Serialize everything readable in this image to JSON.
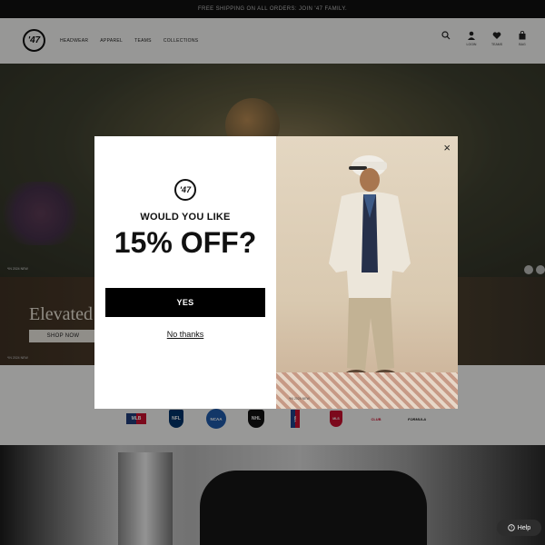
{
  "announcement": "FREE SHIPPING ON ALL ORDERS: JOIN '47 FAMILY.",
  "brand": {
    "logo_text": "'47"
  },
  "nav": [
    {
      "label": "HEADWEAR"
    },
    {
      "label": "APPAREL"
    },
    {
      "label": "TEAMS"
    },
    {
      "label": "COLLECTIONS"
    }
  ],
  "header_icons": [
    {
      "name": "search-icon",
      "label": ""
    },
    {
      "name": "account-icon",
      "label": "LOGIN"
    },
    {
      "name": "heart-icon",
      "label": "TEAMS"
    },
    {
      "name": "bag-icon",
      "label": "BAG"
    }
  ],
  "hero": {
    "credit": "*IN 2024 NEW"
  },
  "promo": {
    "headline": "Elevated",
    "shop_label": "SHOP NOW",
    "credit": "*IN 2024 NEW"
  },
  "leagues": [
    "MLB",
    "NFL",
    "NCAA",
    "NHL",
    "NBA",
    "MLS",
    "CLUB",
    "FORMULA"
  ],
  "modal": {
    "logo_text": "'47",
    "question": "WOULD YOU LIKE",
    "offer": "15% OFF?",
    "yes_label": "YES",
    "no_label": "No thanks",
    "close_symbol": "×",
    "image_credit": "*IN 2024 NEW"
  },
  "help": {
    "label": "Help"
  },
  "colors": {
    "accent": "#000000",
    "modal_bg": "#ffffff",
    "header_bg": "#f4f4f2"
  }
}
